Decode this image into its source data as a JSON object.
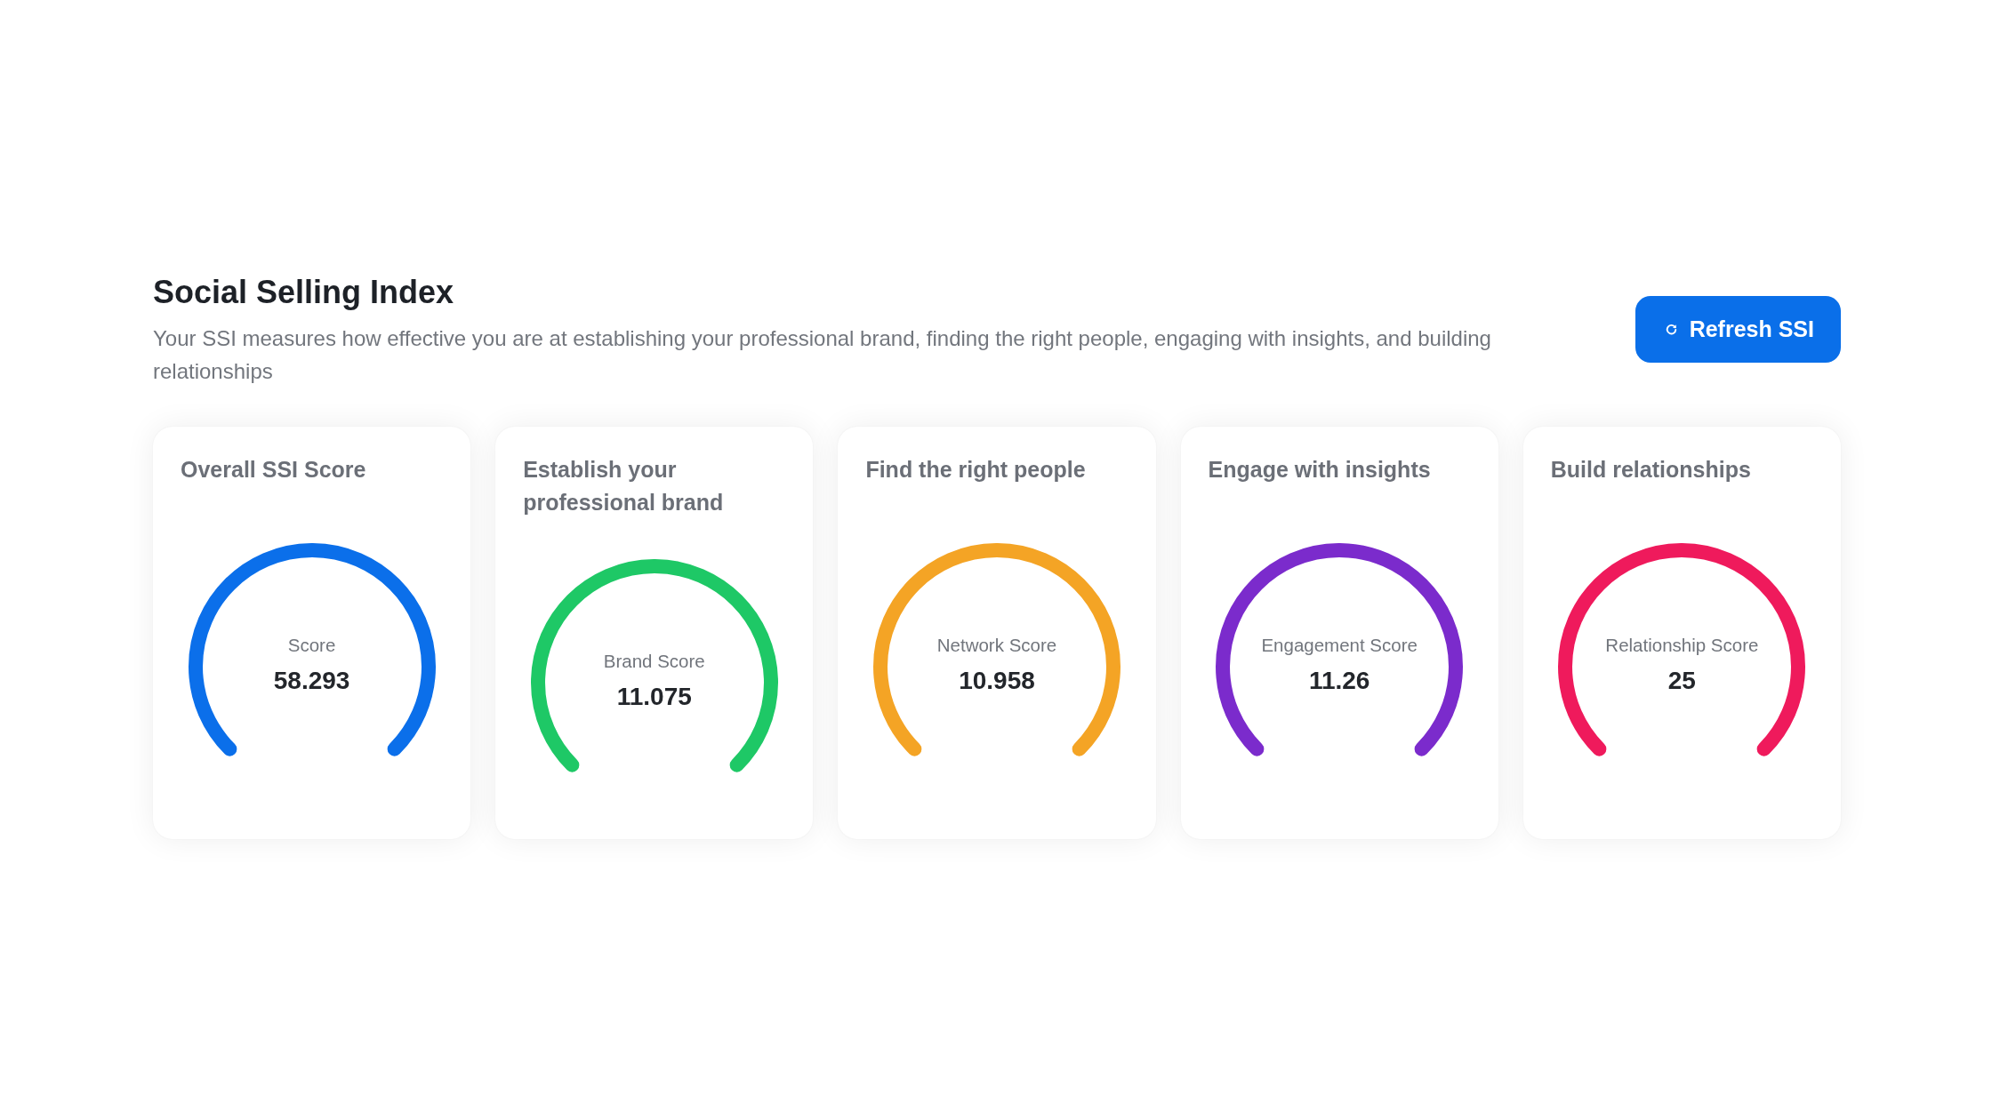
{
  "header": {
    "title": "Social Selling Index",
    "description": "Your SSI measures how effective you are at establishing your professional brand, finding the right people, engaging with insights, and building relationships",
    "refresh_button": {
      "label": "Refresh SSI"
    }
  },
  "cards": [
    {
      "title": "Overall SSI Score",
      "gauge_label": "Score",
      "value": "58.293",
      "color": "#0b6fea"
    },
    {
      "title": "Establish your professional brand",
      "gauge_label": "Brand Score",
      "value": "11.075",
      "color": "#1ec866"
    },
    {
      "title": "Find the right people",
      "gauge_label": "Network Score",
      "value": "10.958",
      "color": "#f4a425"
    },
    {
      "title": "Engage with insights",
      "gauge_label": "Engagement Score",
      "value": "11.26",
      "color": "#7b2bcc"
    },
    {
      "title": "Build relationships",
      "gauge_label": "Relationship Score",
      "value": "25",
      "color": "#ef1a5c"
    }
  ]
}
